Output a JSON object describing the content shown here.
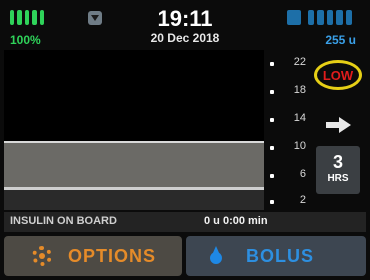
{
  "status": {
    "battery_pct": "100%",
    "time": "19:11",
    "date": "20 Dec 2018",
    "reservoir_units": "255 u"
  },
  "graph": {
    "y_ticks": [
      "22",
      "18",
      "14",
      "10",
      "6",
      "2"
    ],
    "alert": "LOW",
    "trend_icon": "right-arrow-icon",
    "hours_value": "3",
    "hours_label": "HRS"
  },
  "iob": {
    "label": "INSULIN ON BOARD",
    "value": "0 u  0:00 min"
  },
  "buttons": {
    "options": "OPTIONS",
    "bolus": "BOLUS"
  },
  "colors": {
    "battery": "#2fd35a",
    "reservoir": "#1d6fa8",
    "alert_text": "#e11c1c",
    "alert_ring": "#e6cf16",
    "options_accent": "#e58b29",
    "bolus_accent": "#2d8fe0"
  }
}
